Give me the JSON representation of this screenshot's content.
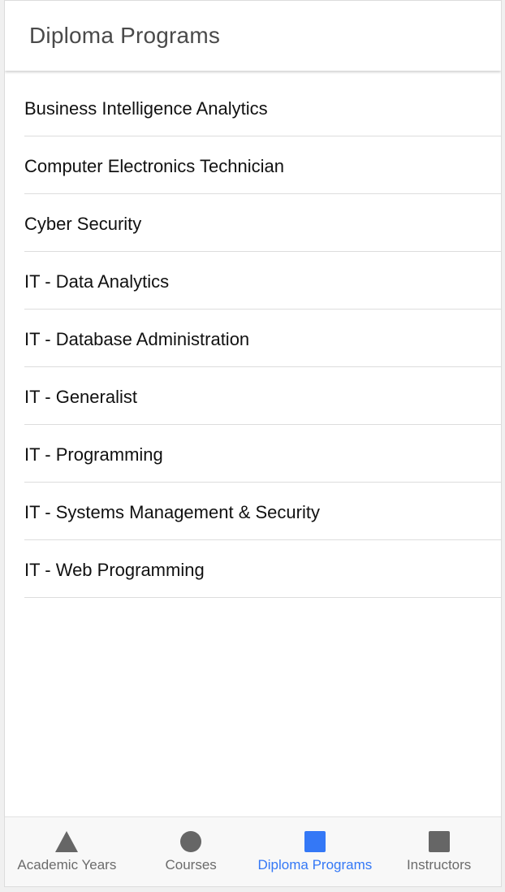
{
  "header": {
    "title": "Diploma Programs"
  },
  "programs": [
    {
      "label": "Business Intelligence Analytics"
    },
    {
      "label": "Computer Electronics Technician"
    },
    {
      "label": "Cyber Security"
    },
    {
      "label": "IT - Data Analytics"
    },
    {
      "label": "IT - Database Administration"
    },
    {
      "label": "IT - Generalist"
    },
    {
      "label": "IT - Programming"
    },
    {
      "label": "IT - Systems Management & Security"
    },
    {
      "label": "IT - Web Programming"
    }
  ],
  "tabs": [
    {
      "label": "Academic Years",
      "icon": "triangle-icon",
      "active": false
    },
    {
      "label": "Courses",
      "icon": "circle-icon",
      "active": false
    },
    {
      "label": "Diploma Programs",
      "icon": "square-icon",
      "active": true
    },
    {
      "label": "Instructors",
      "icon": "square-icon",
      "active": false
    }
  ],
  "colors": {
    "active": "#3478f6",
    "inactive": "#6b6b6b",
    "icon_inactive": "#666666"
  }
}
